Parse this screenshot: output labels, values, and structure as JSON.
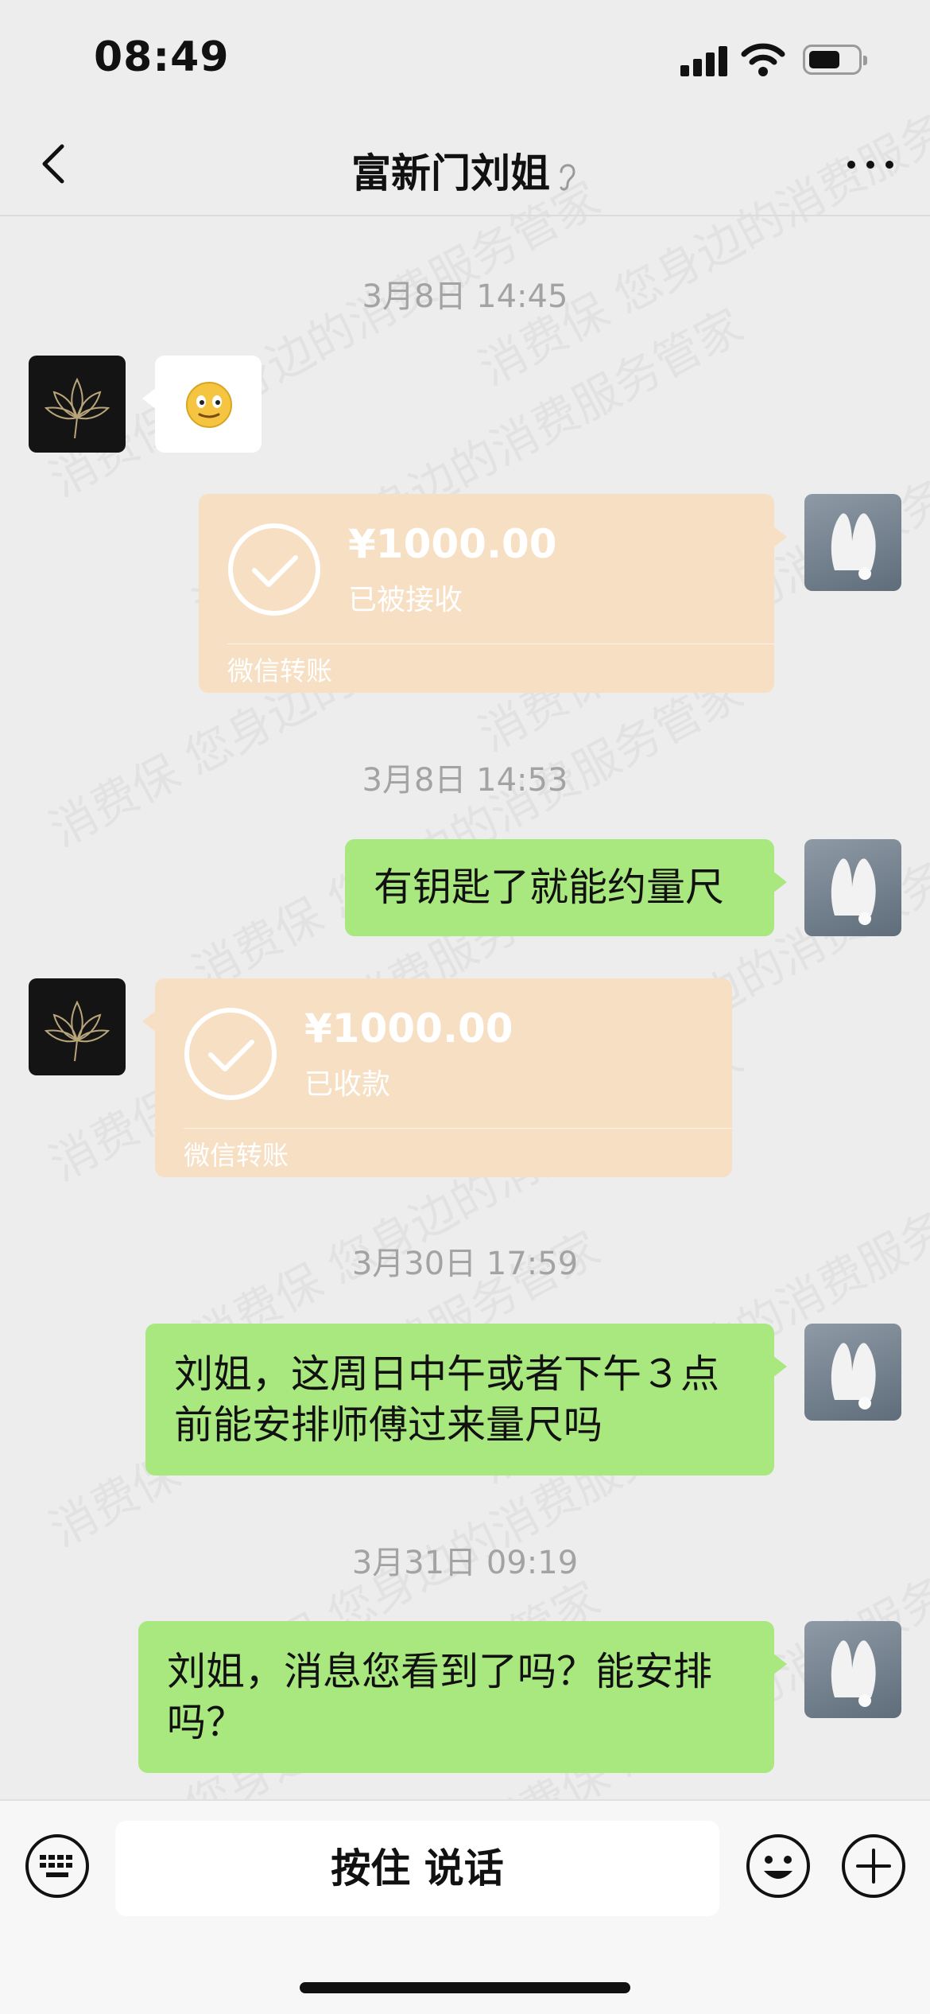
{
  "status_bar": {
    "time": "08:49"
  },
  "header": {
    "title": "富新门刘姐"
  },
  "watermark_text": "消费保 您身边的消费服务管家",
  "messages": [
    {
      "timestamp": "3月8日 14:45"
    },
    {
      "from": "other",
      "type": "emoji",
      "icon": "smiley-emoji"
    },
    {
      "from": "me",
      "type": "transfer",
      "amount": "¥1000.00",
      "status": "已被接收",
      "label": "微信转账"
    },
    {
      "timestamp": "3月8日 14:53"
    },
    {
      "from": "me",
      "type": "text",
      "text": "有钥匙了就能约量尺"
    },
    {
      "from": "other",
      "type": "transfer",
      "amount": "¥1000.00",
      "status": "已收款",
      "label": "微信转账"
    },
    {
      "timestamp": "3月30日 17:59"
    },
    {
      "from": "me",
      "type": "text",
      "lines": [
        "刘姐，这周日中午或者下午３点",
        "前能安排师傅过来量尺吗"
      ]
    },
    {
      "timestamp": "3月31日 09:19"
    },
    {
      "from": "me",
      "type": "text",
      "lines": [
        "刘姐，消息您看到了吗？能安排",
        "吗？"
      ]
    }
  ],
  "input_bar": {
    "voice_label": "按住 说话"
  },
  "colors": {
    "sent_bubble": "#A9E87F",
    "transfer_card": "#F7DFC3",
    "background": "#EDEDED"
  }
}
